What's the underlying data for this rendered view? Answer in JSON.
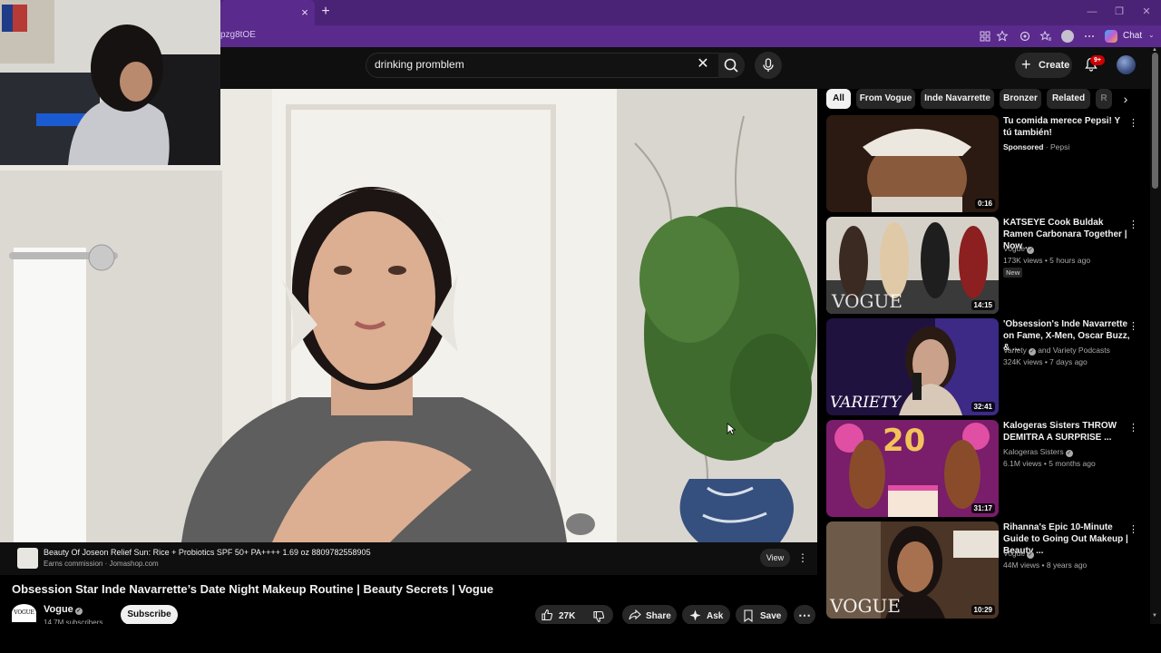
{
  "browser": {
    "tab_close": "×",
    "new_tab": "+",
    "url_fragment": "pzg8tOE",
    "chat_label": "Chat",
    "win_controls": [
      "—",
      "❐",
      "✕"
    ]
  },
  "header": {
    "search_value": "drinking promblem",
    "clear_glyph": "✕",
    "create_label": "Create",
    "notifications_badge": "9+"
  },
  "ad": {
    "title": "Beauty Of Joseon Relief Sun: Rice + Probiotics SPF 50+ PA++++ 1.69 oz 8809782558905",
    "subtitle": "Earns commission · Jomashop.com",
    "view_label": "View",
    "more": "⋮"
  },
  "video": {
    "title": "Obsession Star Inde Navarrette’s Date Night Makeup Routine | Beauty Secrets | Vogue",
    "channel": "Vogue",
    "channel_logo": "VOGUE",
    "subscribers": "14.7M subscribers",
    "subscribe_label": "Subscribe",
    "likes": "27K",
    "share_label": "Share",
    "ask_label": "Ask",
    "save_label": "Save",
    "more": "⋯"
  },
  "chips": {
    "items": [
      "All",
      "From Vogue",
      "Inde Navarrette",
      "Bronzer",
      "Related",
      "R"
    ],
    "active": "All",
    "next": "›"
  },
  "recommendations": [
    {
      "title": "Tu comida merece Pepsi! Y tú también!",
      "channel": "Sponsored · Pepsi",
      "sponsored_label": "Sponsored",
      "advertiser": "Pepsi",
      "meta": "",
      "badge": "",
      "duration": "0:16",
      "thumb_colors": [
        "#3a2418",
        "#b9a58e",
        "#6e4a2c"
      ]
    },
    {
      "title": "KATSEYE Cook Buldak Ramen Carbonara Together | Now ...",
      "channel": "Vogue",
      "meta": "173K views • 5 hours ago",
      "badge": "New",
      "duration": "14:15",
      "thumb_colors": [
        "#2b2b2b",
        "#d9d4cc",
        "#8c1f1f"
      ]
    },
    {
      "title": "'Obsession's Inde Navarrette on Fame, X-Men, Oscar Buzz, & ...",
      "channel": "Variety",
      "channel_extra": "and Variety Podcasts",
      "meta": "324K views • 7 days ago",
      "badge": "",
      "duration": "32:41",
      "thumb_colors": [
        "#1a1030",
        "#3d2a86",
        "#c9a68c"
      ]
    },
    {
      "title": "Kalogeras Sisters THROW DEMITRA A SURPRISE ...",
      "channel": "Kalogeras Sisters",
      "meta": "6.1M views • 5 months ago",
      "badge": "",
      "duration": "31:17",
      "thumb_colors": [
        "#7a1d6a",
        "#e04fa4",
        "#f2c35a"
      ]
    },
    {
      "title": "Rihanna's Epic 10-Minute Guide to Going Out Makeup | Beauty ...",
      "channel": "Vogue",
      "meta": "44M views • 8 years ago",
      "badge": "",
      "duration": "10:29",
      "thumb_colors": [
        "#4a3526",
        "#c7b7a4",
        "#201812"
      ]
    }
  ],
  "colors": {
    "browser_chrome": "#4a2376",
    "page_bg": "#0f0f0f",
    "notification_red": "#cc0000"
  }
}
